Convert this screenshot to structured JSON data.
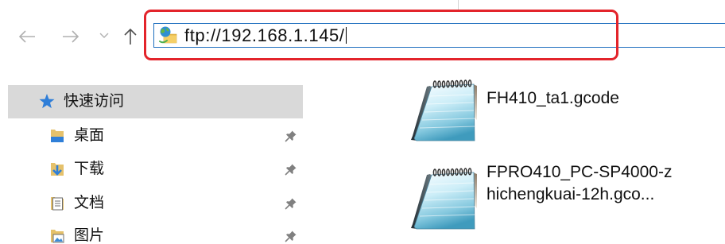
{
  "toolbar": {
    "back_icon": "back-arrow-icon",
    "forward_icon": "forward-arrow-icon",
    "recent_locations_icon": "chevron-down-icon",
    "up_icon": "up-arrow-icon"
  },
  "address_bar": {
    "icon": "ftp-location-icon",
    "value": "ftp://192.168.1.145/",
    "focused": true
  },
  "sidebar": {
    "quick_access": {
      "label": "快速访问",
      "icon": "star-icon",
      "selected": true
    },
    "items": [
      {
        "label": "桌面",
        "icon": "desktop-folder-icon",
        "pinned": true
      },
      {
        "label": "下载",
        "icon": "downloads-folder-icon",
        "pinned": true
      },
      {
        "label": "文档",
        "icon": "documents-folder-icon",
        "pinned": true
      },
      {
        "label": "图片",
        "icon": "pictures-folder-icon",
        "pinned": true
      }
    ]
  },
  "files": [
    {
      "icon": "notepad-file-icon",
      "name_lines": [
        "FH410_ta1.gcode"
      ]
    },
    {
      "icon": "notepad-file-icon",
      "name_lines": [
        "FPRO410_PC-SP4000-z",
        "hichengkuai-12h.gco..."
      ]
    }
  ],
  "colors": {
    "annotation_red": "#e3242b",
    "address_focus_border": "#1f6fbf",
    "selected_item_bg": "#d9d9d9",
    "quick_access_star": "#2f7ed8",
    "disabled_nav_arrow": "#b0b0b0",
    "enabled_nav_arrow": "#505050"
  }
}
